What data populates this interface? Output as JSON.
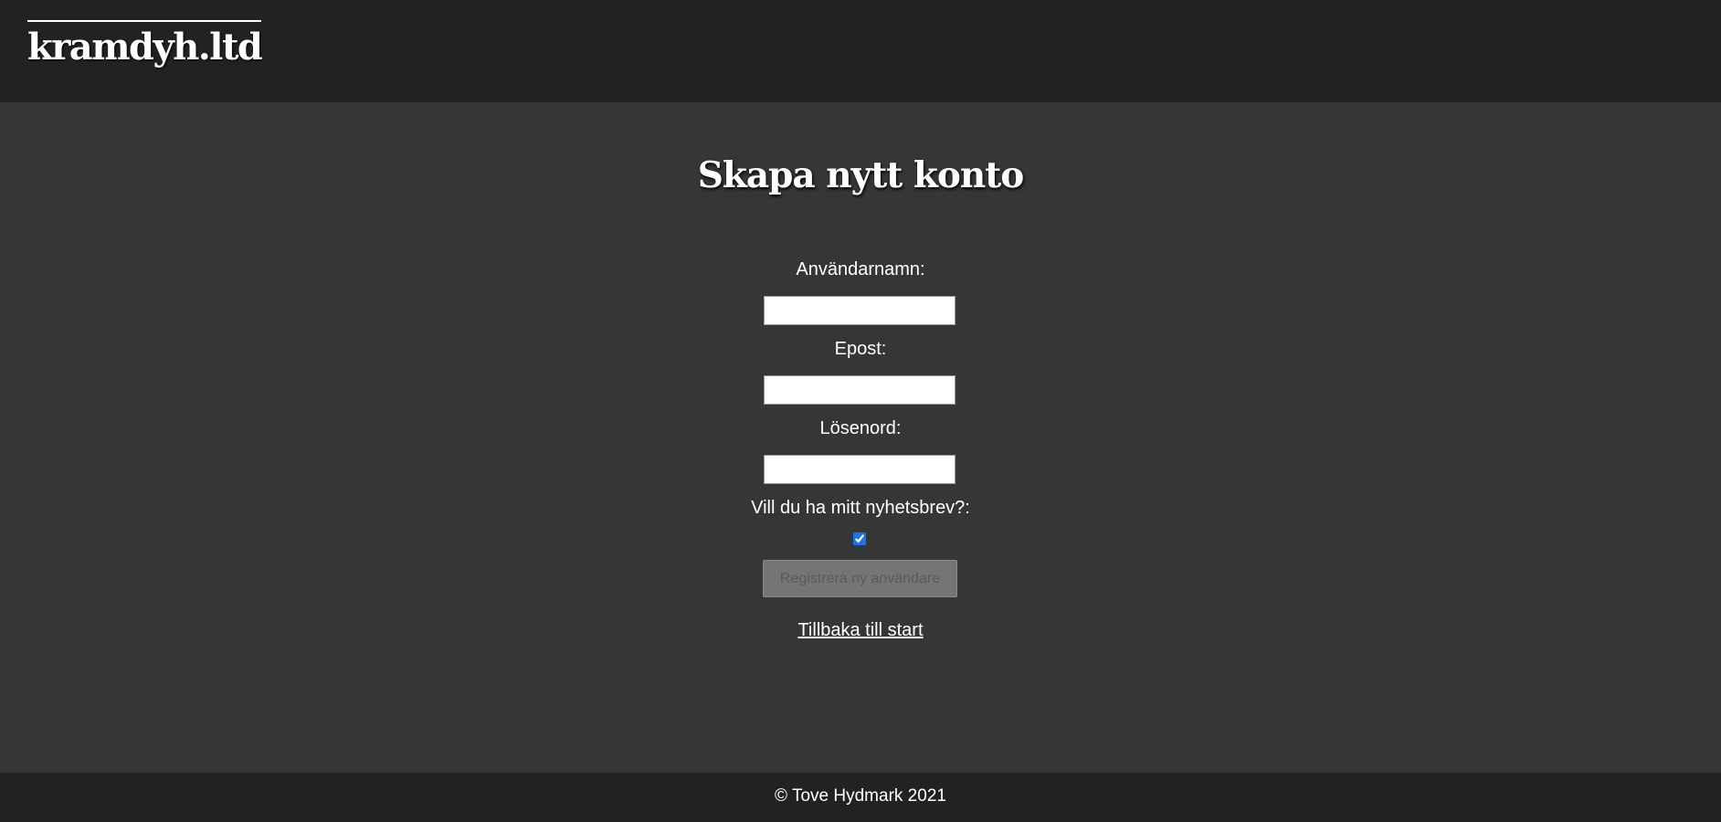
{
  "header": {
    "logo_text": "kramdyh.ltd"
  },
  "main": {
    "title": "Skapa nytt konto",
    "form": {
      "username_label": "Användarnamn:",
      "username_value": "",
      "email_label": "Epost:",
      "email_value": "",
      "password_label": "Lösenord:",
      "password_value": "",
      "newsletter_label": "Vill du ha mitt nyhetsbrev?:",
      "newsletter_checked": true,
      "submit_label": "Registrera ny användare"
    },
    "back_link_label": "Tillbaka till start"
  },
  "footer": {
    "copyright": "© Tove Hydmark 2021"
  },
  "colors": {
    "header_bg": "#222222",
    "main_bg": "#353736",
    "footer_bg": "#222222",
    "button_bg": "#757575",
    "checkbox_accent": "#1a73e8"
  }
}
